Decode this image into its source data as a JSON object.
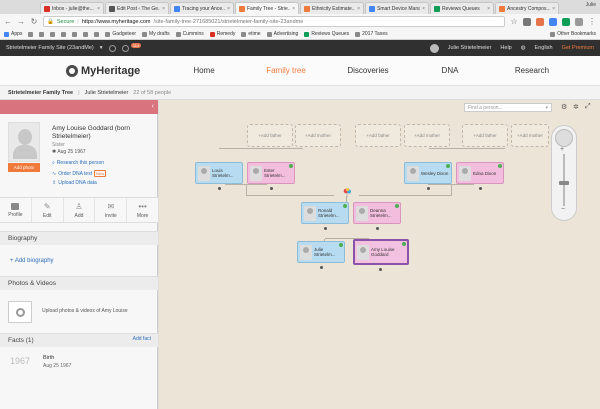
{
  "browser": {
    "tabs": [
      {
        "label": "Inbox - julie@the...",
        "color": "#d93025"
      },
      {
        "label": "Edit Post ‹ The Ge...",
        "color": "#555555"
      },
      {
        "label": "Tracing your Ance...",
        "color": "#4285f4"
      },
      {
        "label": "Family Tree - Strie...",
        "color": "#f07a3c"
      },
      {
        "label": "Ethnicity Estimate...",
        "color": "#f07a3c"
      },
      {
        "label": "Smart Device Mana...",
        "color": "#4285f4"
      },
      {
        "label": "Reviews Queues",
        "color": "#0f9d58"
      },
      {
        "label": "Ancestry Compos...",
        "color": "#f07a3c"
      }
    ],
    "user": "Julie",
    "secure_label": "Secure",
    "url_host": "https://www.myheritage.com",
    "url_path": "/site-family-tree-271685021/strietelmeier-family-site-23andme",
    "bookmarks": [
      "Apps",
      "Gadgeteer",
      "My drafts",
      "Cummins",
      "Remedy",
      "etime",
      "Advertising",
      "Reviews Queues",
      "2017 Taxes"
    ],
    "other_bookmarks": "Other Bookmarks"
  },
  "mh_bar": {
    "site_name": "Strietelmeier Family Site (23andMe)",
    "badge": "314",
    "user_name": "Julie Strietelmeier",
    "help": "Help",
    "language": "English",
    "premium": "Get Premium"
  },
  "nav": {
    "logo": "MyHeritage",
    "items": [
      "Home",
      "Family tree",
      "Discoveries",
      "DNA",
      "Research"
    ],
    "active": "Family tree"
  },
  "subheader": {
    "tree_name": "Strietelmeier Family Tree",
    "owner": "Julie Strietelmeier",
    "count": "22 of 58 people"
  },
  "profile": {
    "name": "Amy Louise Goddard (born Strietelmeier)",
    "relation": "Sister",
    "born": "Aug 25 1967",
    "add_photo": "Add photo",
    "links": [
      "Research this person",
      "Order DNA test",
      "Upload DNA data"
    ],
    "new_badge": "New",
    "actions": [
      "Profile",
      "Edit",
      "Add",
      "Invite",
      "More"
    ],
    "biography_title": "Biography",
    "add_biography": "+ Add biography",
    "photos_title": "Photos & Videos",
    "upload_text": "Upload photos & videos of Amy Louise",
    "facts_title": "Facts (1)",
    "add_fact": "Add fact",
    "fact_year": "1967",
    "fact_name": "Birth",
    "fact_date": "Aug 25 1967"
  },
  "tree": {
    "find_placeholder": "Find a person...",
    "add_father": "+Add father",
    "add_mother": "+Add mother",
    "people": {
      "louis": "Louis Strietelm...",
      "ester": "Ester Strietelm...",
      "wesley": "Wesley Dixon",
      "edna": "Edna Dixon",
      "ronald": "Ronald Strietelm...",
      "deanna": "Deanna Strietelm...",
      "julie": "Julie Strietelm...",
      "amy": "Amy Louise Goddard"
    }
  }
}
